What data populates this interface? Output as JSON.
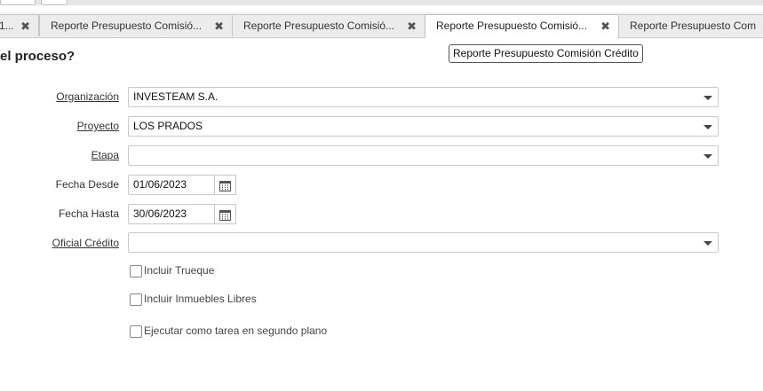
{
  "tabs": [
    {
      "label": "1...",
      "close": "✖"
    },
    {
      "label": "Reporte Presupuesto Comisió...",
      "close": "✖"
    },
    {
      "label": "Reporte Presupuesto Comisió...",
      "close": "✖"
    },
    {
      "label": "Reporte Presupuesto Comisió...",
      "close": "✖"
    },
    {
      "label": "Reporte Presupuesto Com"
    }
  ],
  "tooltip": "Reporte Presupuesto Comisión Crédito",
  "heading": "el proceso?",
  "form": {
    "organizacion": {
      "label": "Organización",
      "value": "INVESTEAM S.A."
    },
    "proyecto": {
      "label": "Proyecto",
      "value": "LOS PRADOS"
    },
    "etapa": {
      "label": "Etapa",
      "value": ""
    },
    "fecha_desde": {
      "label": "Fecha Desde",
      "value": "01/06/2023"
    },
    "fecha_hasta": {
      "label": "Fecha Hasta",
      "value": "30/06/2023"
    },
    "oficial_credito": {
      "label": "Oficial Crédito",
      "value": ""
    },
    "incluir_trueque": {
      "label": "Incluir Trueque",
      "checked": false
    },
    "incluir_inmuebles": {
      "label": "Incluir Inmuebles Libres",
      "checked": false
    },
    "segundo_plano": {
      "label": "Ejecutar como tarea en segundo plano",
      "checked": false
    }
  },
  "icons": {
    "dropdown": "chevron-down-icon",
    "calendar": "calendar-icon",
    "close": "close-icon"
  }
}
